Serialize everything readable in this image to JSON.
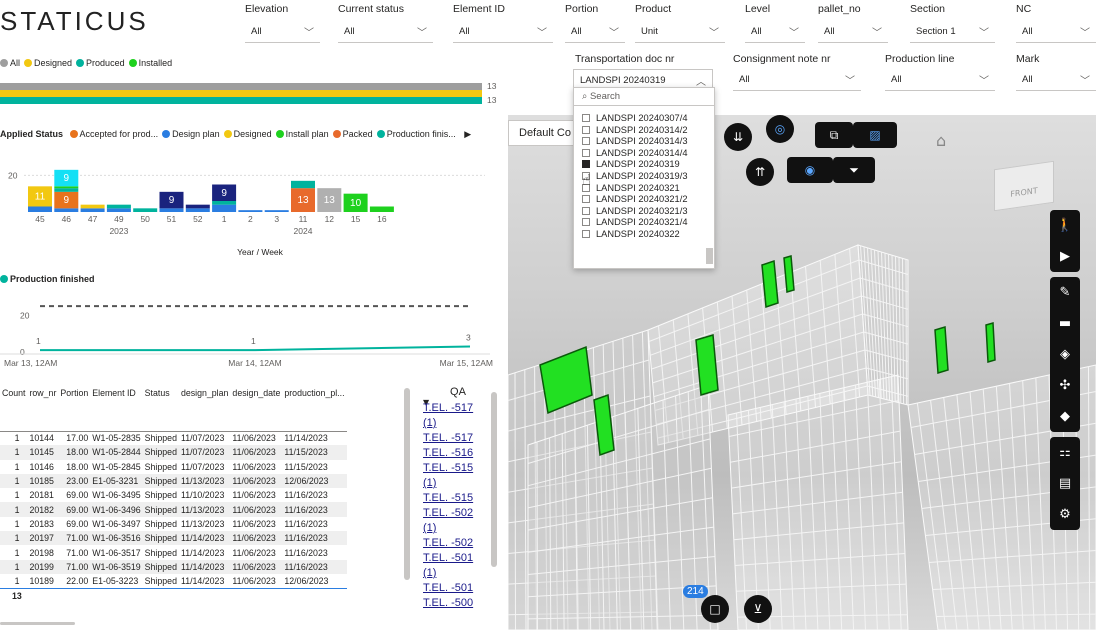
{
  "app": {
    "logo": "STATICUS"
  },
  "slicers_row1": [
    {
      "label": "Elevation",
      "value": "All"
    },
    {
      "label": "Current status",
      "value": "All"
    },
    {
      "label": "Element ID",
      "value": "All"
    },
    {
      "label": "Portion",
      "value": "All"
    },
    {
      "label": "Product",
      "value": "Unit"
    },
    {
      "label": "Level",
      "value": "All"
    },
    {
      "label": "pallet_no",
      "value": "All"
    },
    {
      "label": "Section",
      "value": "Section 1"
    },
    {
      "label": "NC",
      "value": "All"
    }
  ],
  "slicers_row2": [
    {
      "label": "Transportation doc nr",
      "value": "LANDSPI 20240319"
    },
    {
      "label": "Consignment note nr",
      "value": "All"
    },
    {
      "label": "Production line",
      "value": "All"
    },
    {
      "label": "Mark",
      "value": "All"
    }
  ],
  "dropdown": {
    "search_placeholder": "Search",
    "items": [
      {
        "label": "LANDSPI 20240307/4",
        "checked": false
      },
      {
        "label": "LANDSPI 20240314/2",
        "checked": false
      },
      {
        "label": "LANDSPI 20240314/3",
        "checked": false
      },
      {
        "label": "LANDSPI 20240314/4",
        "checked": false
      },
      {
        "label": "LANDSPI 20240319",
        "checked": true
      },
      {
        "label": "LANDSPI 20240319/3",
        "checked": false
      },
      {
        "label": "LANDSPI 20240321",
        "checked": false
      },
      {
        "label": "LANDSPI 20240321/2",
        "checked": false
      },
      {
        "label": "LANDSPI 20240321/3",
        "checked": false
      },
      {
        "label": "LANDSPI 20240321/4",
        "checked": false
      },
      {
        "label": "LANDSPI 20240322",
        "checked": false
      }
    ]
  },
  "status_bar": {
    "legend": [
      {
        "label": "All",
        "color": "#9e9e9e"
      },
      {
        "label": "Designed",
        "color": "#f2c811"
      },
      {
        "label": "Produced",
        "color": "#00b39d"
      },
      {
        "label": "Installed",
        "color": "#1ed11e"
      }
    ],
    "bars": [
      {
        "series": "All",
        "value": 13
      },
      {
        "series": "Designed",
        "value": 13
      },
      {
        "series": "Produced",
        "value": 13
      }
    ]
  },
  "chart_data": [
    {
      "type": "bar",
      "legend_title": "Applied Status",
      "legend_items": [
        {
          "label": "Accepted for prod...",
          "color": "#e8731c"
        },
        {
          "label": "Design plan",
          "color": "#2a7de1"
        },
        {
          "label": "Designed",
          "color": "#f2c811"
        },
        {
          "label": "Install plan",
          "color": "#1ed11e"
        },
        {
          "label": "Packed",
          "color": "#e86a2c"
        },
        {
          "label": "Production finis...",
          "color": "#00b39d"
        }
      ],
      "categories": [
        "45",
        "46",
        "47",
        "49",
        "50",
        "51",
        "52",
        "1",
        "2",
        "3",
        "11",
        "12",
        "15",
        "16"
      ],
      "year_labels": [
        {
          "label": "2023",
          "at": "49"
        },
        {
          "label": "2024",
          "at": "11"
        }
      ],
      "xlabel": "Year / Week",
      "ylabel": "",
      "ylim": [
        0,
        30
      ],
      "yticks": [
        20
      ],
      "segments": [
        [
          {
            "color": "#2a7de1",
            "value": 3
          },
          {
            "color": "#f2c811",
            "value": 11
          }
        ],
        [
          {
            "color": "#2a7de1",
            "value": 2
          },
          {
            "color": "#e8731c",
            "value": 9
          },
          {
            "color": "#00b39d",
            "value": 2
          },
          {
            "color": "#1ed11e",
            "value": 1
          },
          {
            "color": "#14e0f5",
            "value": 9
          }
        ],
        [
          {
            "color": "#2a7de1",
            "value": 2
          },
          {
            "color": "#f2c811",
            "value": 2
          }
        ],
        [
          {
            "color": "#2a7de1",
            "value": 2
          },
          {
            "color": "#00b39d",
            "value": 2
          }
        ],
        [
          {
            "color": "#00b39d",
            "value": 2
          }
        ],
        [
          {
            "color": "#2a7de1",
            "value": 2
          },
          {
            "color": "#1a237e",
            "value": 9
          }
        ],
        [
          {
            "color": "#2a7de1",
            "value": 2
          },
          {
            "color": "#1a237e",
            "value": 2
          }
        ],
        [
          {
            "color": "#2a7de1",
            "value": 4
          },
          {
            "color": "#00b39d",
            "value": 2
          },
          {
            "color": "#1a237e",
            "value": 9
          }
        ],
        [
          {
            "color": "#2a7de1",
            "value": 1
          }
        ],
        [
          {
            "color": "#2a7de1",
            "value": 1
          }
        ],
        [
          {
            "color": "#e86a2c",
            "value": 13
          },
          {
            "color": "#00b39d",
            "value": 4
          }
        ],
        [
          {
            "color": "#b0b0b0",
            "value": 13
          }
        ],
        [
          {
            "color": "#1ed11e",
            "value": 10
          }
        ],
        [
          {
            "color": "#1ed11e",
            "value": 3
          }
        ]
      ],
      "data_labels": [
        {
          "category": "45",
          "value": 11
        },
        {
          "category": "46",
          "value": 9
        },
        {
          "category": "46",
          "value": 9,
          "top": true
        },
        {
          "category": "51",
          "value": 9
        },
        {
          "category": "1",
          "value": 9
        },
        {
          "category": "11",
          "value": 13
        },
        {
          "category": "12",
          "value": 13
        },
        {
          "category": "15",
          "value": 10
        }
      ]
    },
    {
      "type": "line",
      "legend_title": "",
      "legend_items": [
        {
          "label": "Production finished",
          "color": "#00b39d"
        }
      ],
      "x_labels": [
        "Mar 13, 12AM",
        "Mar 14, 12AM",
        "Mar 15, 12AM"
      ],
      "ylim": [
        0,
        30
      ],
      "yticks": [
        0,
        20
      ],
      "target": 25,
      "points": [
        {
          "x": 0,
          "y": 1
        },
        {
          "x": 1,
          "y": 1
        },
        {
          "x": 2,
          "y": 3
        }
      ]
    }
  ],
  "table": {
    "columns": [
      "Count",
      "row_nr",
      "Portion",
      "Element ID",
      "Status",
      "design_plan",
      "design_date",
      "production_pl..."
    ],
    "rows": [
      [
        "1",
        "10144",
        "17.00",
        "W1-05-2835",
        "Shipped",
        "11/07/2023",
        "11/06/2023",
        "11/14/2023"
      ],
      [
        "1",
        "10145",
        "18.00",
        "W1-05-2844",
        "Shipped",
        "11/07/2023",
        "11/06/2023",
        "11/15/2023"
      ],
      [
        "1",
        "10146",
        "18.00",
        "W1-05-2845",
        "Shipped",
        "11/07/2023",
        "11/06/2023",
        "11/15/2023"
      ],
      [
        "1",
        "10185",
        "23.00",
        "E1-05-3231",
        "Shipped",
        "11/13/2023",
        "11/06/2023",
        "12/06/2023"
      ],
      [
        "1",
        "20181",
        "69.00",
        "W1-06-3495",
        "Shipped",
        "11/10/2023",
        "11/06/2023",
        "11/16/2023"
      ],
      [
        "1",
        "20182",
        "69.00",
        "W1-06-3496",
        "Shipped",
        "11/13/2023",
        "11/06/2023",
        "11/16/2023"
      ],
      [
        "1",
        "20183",
        "69.00",
        "W1-06-3497",
        "Shipped",
        "11/13/2023",
        "11/06/2023",
        "11/16/2023"
      ],
      [
        "1",
        "20197",
        "71.00",
        "W1-06-3516",
        "Shipped",
        "11/14/2023",
        "11/06/2023",
        "11/16/2023"
      ],
      [
        "1",
        "20198",
        "71.00",
        "W1-06-3517",
        "Shipped",
        "11/14/2023",
        "11/06/2023",
        "11/16/2023"
      ],
      [
        "1",
        "20199",
        "71.00",
        "W1-06-3519",
        "Shipped",
        "11/14/2023",
        "11/06/2023",
        "11/16/2023"
      ],
      [
        "1",
        "10189",
        "22.00",
        "E1-05-3223",
        "Shipped",
        "11/14/2023",
        "11/06/2023",
        "12/06/2023"
      ]
    ],
    "total": "13"
  },
  "qa": {
    "header": "QA",
    "links": [
      "T.EL. -517",
      "(1)",
      "T.EL. -517",
      "T.EL. -516",
      "T.EL. -515",
      "(1)",
      "T.EL. -515",
      "T.EL. -502",
      "(1)",
      "T.EL. -502",
      "T.EL. -501",
      "(1)",
      "T.EL. -501",
      "T.EL. -500"
    ]
  },
  "viewer": {
    "view_select": "Default Co",
    "count_badge": "214",
    "cube_label": "FRONT"
  }
}
